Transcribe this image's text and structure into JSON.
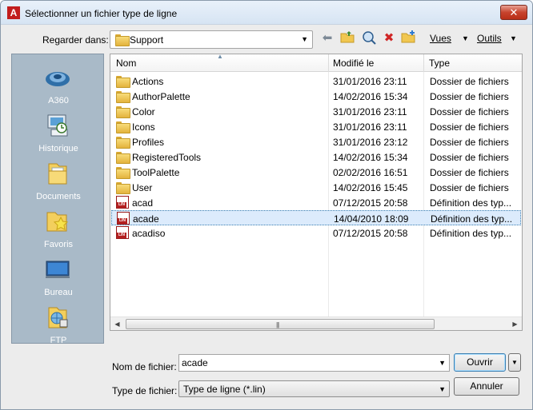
{
  "window": {
    "title": "Sélectionner un fichier type de ligne",
    "close_label": "✕"
  },
  "lookin": {
    "label": "Regarder dans:",
    "value": "Support"
  },
  "toolbar": {
    "views_label": "Vues",
    "tools_label": "Outils"
  },
  "places": [
    {
      "label": "A360",
      "icon": "a360-icon"
    },
    {
      "label": "Historique",
      "icon": "history-icon"
    },
    {
      "label": "Documents",
      "icon": "documents-icon"
    },
    {
      "label": "Favoris",
      "icon": "favorites-icon"
    },
    {
      "label": "Bureau",
      "icon": "desktop-icon"
    },
    {
      "label": "FTP",
      "icon": "ftp-icon"
    }
  ],
  "columns": {
    "name": "Nom",
    "modified": "Modifié le",
    "type": "Type"
  },
  "files": [
    {
      "name": "Actions",
      "date": "31/01/2016 23:11",
      "type": "Dossier de fichiers",
      "kind": "folder"
    },
    {
      "name": "AuthorPalette",
      "date": "14/02/2016 15:34",
      "type": "Dossier de fichiers",
      "kind": "folder"
    },
    {
      "name": "Color",
      "date": "31/01/2016 23:11",
      "type": "Dossier de fichiers",
      "kind": "folder"
    },
    {
      "name": "Icons",
      "date": "31/01/2016 23:11",
      "type": "Dossier de fichiers",
      "kind": "folder"
    },
    {
      "name": "Profiles",
      "date": "31/01/2016 23:12",
      "type": "Dossier de fichiers",
      "kind": "folder"
    },
    {
      "name": "RegisteredTools",
      "date": "14/02/2016 15:34",
      "type": "Dossier de fichiers",
      "kind": "folder"
    },
    {
      "name": "ToolPalette",
      "date": "02/02/2016 16:51",
      "type": "Dossier de fichiers",
      "kind": "folder"
    },
    {
      "name": "User",
      "date": "14/02/2016 15:45",
      "type": "Dossier de fichiers",
      "kind": "folder"
    },
    {
      "name": "acad",
      "date": "07/12/2015 20:58",
      "type": "Définition des typ...",
      "kind": "lin"
    },
    {
      "name": "acade",
      "date": "14/04/2010 18:09",
      "type": "Définition des typ...",
      "kind": "lin",
      "selected": true
    },
    {
      "name": "acadiso",
      "date": "07/12/2015 20:58",
      "type": "Définition des typ...",
      "kind": "lin"
    }
  ],
  "filename": {
    "label": "Nom de fichier:",
    "value": "acade"
  },
  "filetype": {
    "label": "Type de fichier:",
    "value": "Type de ligne (*.lin)"
  },
  "buttons": {
    "open": "Ouvrir",
    "cancel": "Annuler"
  }
}
